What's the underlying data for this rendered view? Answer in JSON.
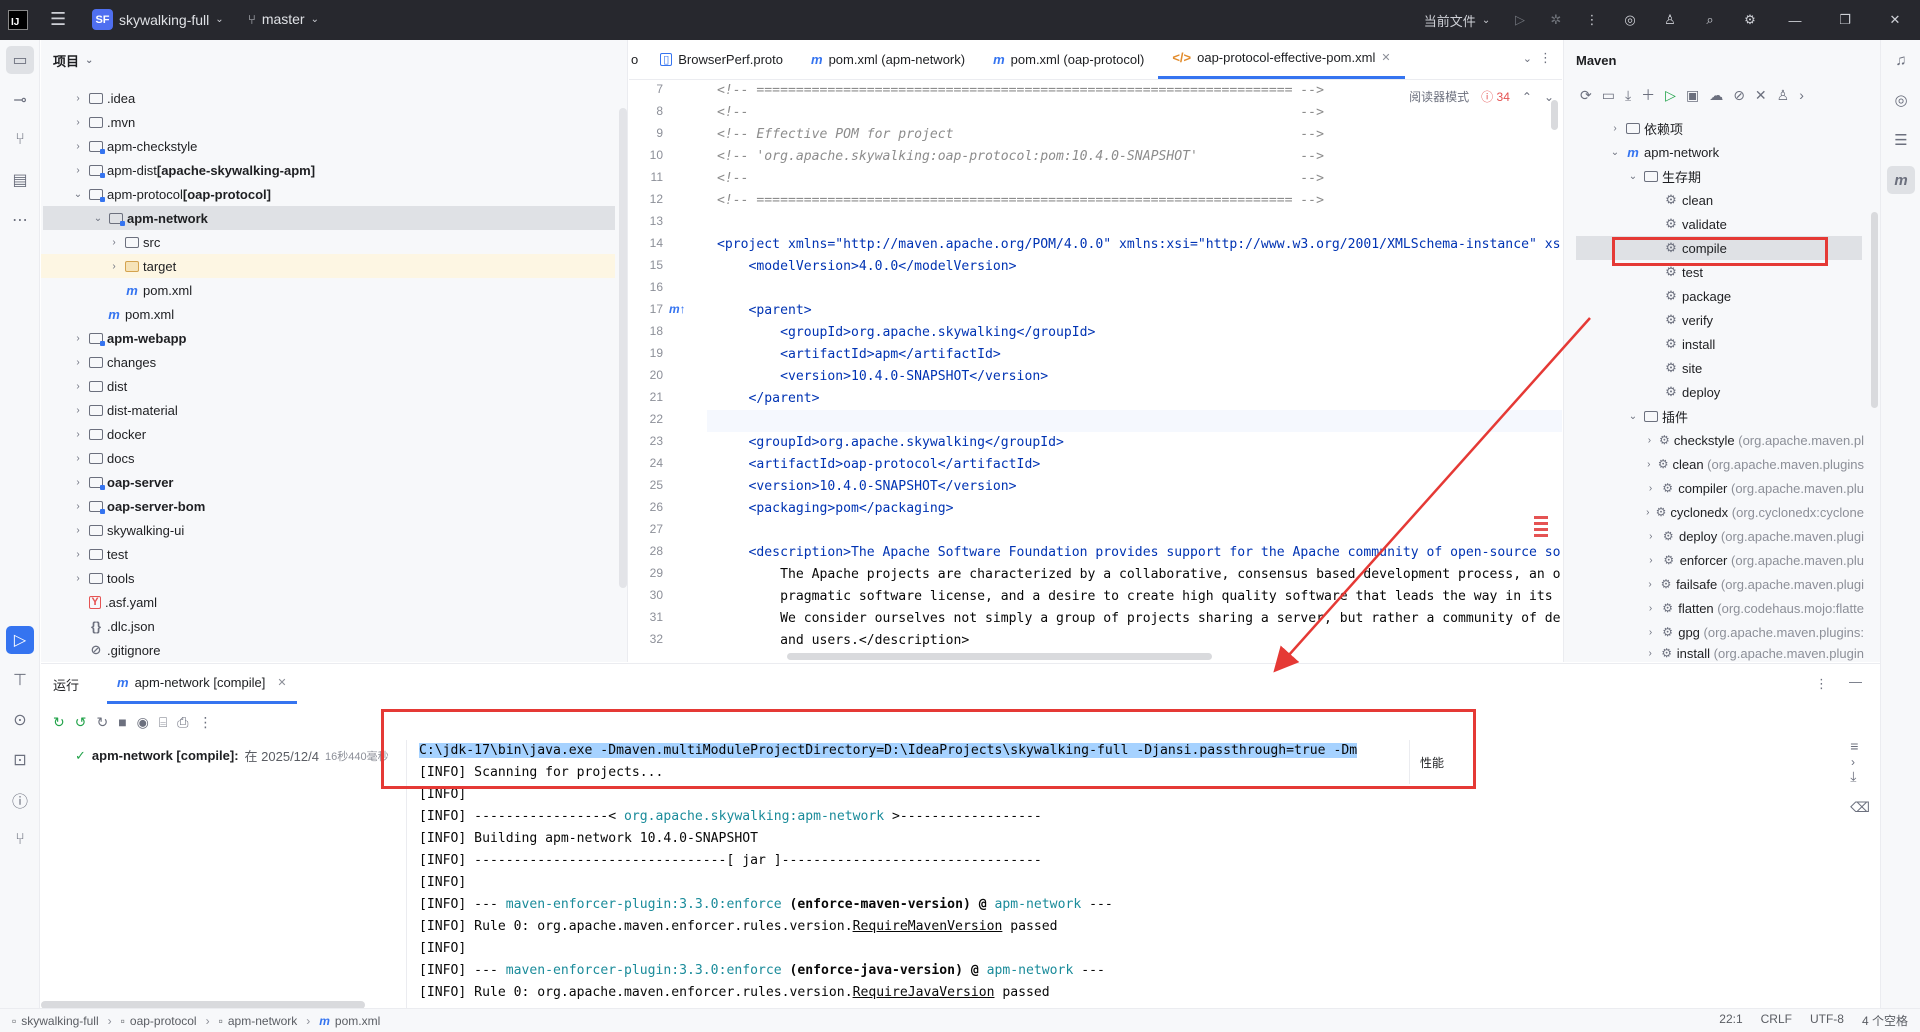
{
  "titlebar": {
    "logo_text": "IJ",
    "project_badge": "SF",
    "project_name": "skywalking-full",
    "branch": "master",
    "current_file": "当前文件"
  },
  "project_panel": {
    "title": "项目",
    "items": [
      {
        "label": "",
        "bold": ".idea"
      },
      {
        "label": ".mvn"
      },
      {
        "label": "apm-checkstyle"
      },
      {
        "label": "apm-dist ",
        "bold": "[apache-skywalking-apm]"
      },
      {
        "label": "apm-protocol ",
        "bold": "[oap-protocol]"
      },
      {
        "label": "apm-network"
      },
      {
        "label": "src"
      },
      {
        "label": "target"
      },
      {
        "label": "pom.xml"
      },
      {
        "label": "pom.xml"
      },
      {
        "label": "apm-webapp"
      },
      {
        "label": "changes"
      },
      {
        "label": "dist"
      },
      {
        "label": "dist-material"
      },
      {
        "label": "docker"
      },
      {
        "label": "docs"
      },
      {
        "label": "oap-server"
      },
      {
        "label": "oap-server-bom"
      },
      {
        "label": "skywalking-ui"
      },
      {
        "label": "test"
      },
      {
        "label": "tools"
      },
      {
        "label": ".asf.yaml"
      },
      {
        "label": ".dlc.json"
      },
      {
        "label": ".gitignore"
      }
    ]
  },
  "editor": {
    "tabs": [
      {
        "label": "o"
      },
      {
        "label": "BrowserPerf.proto"
      },
      {
        "label": "pom.xml (apm-network)"
      },
      {
        "label": "pom.xml (oap-protocol)"
      },
      {
        "label": "oap-protocol-effective-pom.xml"
      }
    ],
    "reader_mode": "阅读器模式",
    "error_count": "34",
    "line_numbers": [
      "7",
      "8",
      "9",
      "10",
      "11",
      "12",
      "13",
      "14",
      "15",
      "16",
      "17",
      "18",
      "19",
      "20",
      "21",
      "22",
      "23",
      "24",
      "25",
      "26",
      "27",
      "28",
      "29",
      "30",
      "31",
      "32"
    ],
    "lines": [
      "<!-- ==================================================================== -->",
      "<!--                                                                      -->",
      "<!-- Effective POM for project                                            -->",
      "<!-- 'org.apache.skywalking:oap-protocol:pom:10.4.0-SNAPSHOT'             -->",
      "<!--                                                                      -->",
      "<!-- ==================================================================== -->",
      "",
      "<project xmlns=\"http://maven.apache.org/POM/4.0.0\" xmlns:xsi=\"http://www.w3.org/2001/XMLSchema-instance\" xs",
      "    <modelVersion>4.0.0</modelVersion>",
      "",
      "    <parent>",
      "        <groupId>org.apache.skywalking</groupId>",
      "        <artifactId>apm</artifactId>",
      "        <version>10.4.0-SNAPSHOT</version>",
      "    </parent>",
      "",
      "    <groupId>org.apache.skywalking</groupId>",
      "    <artifactId>oap-protocol</artifactId>",
      "    <version>10.4.0-SNAPSHOT</version>",
      "    <packaging>pom</packaging>",
      "",
      "    <description>The Apache Software Foundation provides support for the Apache community of open-source so",
      "        The Apache projects are characterized by a collaborative, consensus based development process, an o",
      "        pragmatic software license, and a desire to create high quality software that leads the way in its",
      "        We consider ourselves not simply a group of projects sharing a server, but rather a community of de",
      "        and users.</description>"
    ]
  },
  "maven_panel": {
    "title": "Maven",
    "items": [
      {
        "label": "依赖项"
      },
      {
        "label": "apm-network"
      },
      {
        "label": "生存期"
      },
      {
        "label": "clean"
      },
      {
        "label": "validate"
      },
      {
        "label": "compile"
      },
      {
        "label": "test"
      },
      {
        "label": "package"
      },
      {
        "label": "verify"
      },
      {
        "label": "install"
      },
      {
        "label": "site"
      },
      {
        "label": "deploy"
      },
      {
        "label": "插件"
      },
      {
        "label": "checkstyle",
        "gray": "(org.apache.maven.pl"
      },
      {
        "label": "clean",
        "gray": "(org.apache.maven.plugins"
      },
      {
        "label": "compiler",
        "gray": "(org.apache.maven.plu"
      },
      {
        "label": "cyclonedx",
        "gray": "(org.cyclonedx:cyclone"
      },
      {
        "label": "deploy",
        "gray": "(org.apache.maven.plugi"
      },
      {
        "label": "enforcer",
        "gray": "(org.apache.maven.plu"
      },
      {
        "label": "failsafe",
        "gray": "(org.apache.maven.plugi"
      },
      {
        "label": "flatten",
        "gray": "(org.codehaus.mojo:flatte"
      },
      {
        "label": "gpg",
        "gray": "(org.apache.maven.plugins:"
      },
      {
        "label": "install",
        "gray": "(org.apache.maven.plugin"
      }
    ]
  },
  "run_panel": {
    "title": "运行",
    "tab_label": "apm-network [compile]",
    "run_item": "apm-network [compile]:",
    "run_item_meta": "在 2025/12/4",
    "run_item_time": "16秒440毫秒",
    "perf_label": "性能",
    "console": [
      {
        "text": "C:\\jdk-17\\bin\\java.exe -Dmaven.multiModuleProjectDirectory=D:\\IdeaProjects\\skywalking-full -Djansi.passthrough=true -Dm"
      },
      {
        "text": "[INFO] Scanning for projects..."
      },
      {
        "text": "[INFO]"
      },
      {
        "pre": "[INFO] -----------------< ",
        "link": "org.apache.skywalking:apm-network",
        "post": " >------------------"
      },
      {
        "text": "[INFO] Building apm-network 10.4.0-SNAPSHOT"
      },
      {
        "text": "[INFO] --------------------------------[ jar ]---------------------------------"
      },
      {
        "text": "[INFO]"
      },
      {
        "pre": "[INFO] --- ",
        "link": "maven-enforcer-plugin:3.3.0:enforce",
        "mid": " (enforce-maven-version) @ ",
        "link2": "apm-network",
        "post": " ---"
      },
      {
        "pre": "[INFO] Rule 0: org.apache.maven.enforcer.rules.version.",
        "und": "RequireMavenVersion",
        "post": " passed"
      },
      {
        "text": "[INFO]"
      },
      {
        "pre": "[INFO] --- ",
        "link": "maven-enforcer-plugin:3.3.0:enforce",
        "mid": " (enforce-java-version) @ ",
        "link2": "apm-network",
        "post": " ---"
      },
      {
        "pre": "[INFO] Rule 0: org.apache.maven.enforcer.rules.version.",
        "und": "RequireJavaVersion",
        "post": " passed"
      }
    ]
  },
  "statusbar": {
    "crumbs": [
      "skywalking-full",
      "oap-protocol",
      "apm-network",
      "pom.xml"
    ],
    "position": "22:1",
    "line_sep": "CRLF",
    "encoding": "UTF-8",
    "indent": "4 个空格"
  },
  "colors": {
    "accent": "#3574f0",
    "annotation": "#e53935",
    "selection": "#a6d2ff"
  }
}
